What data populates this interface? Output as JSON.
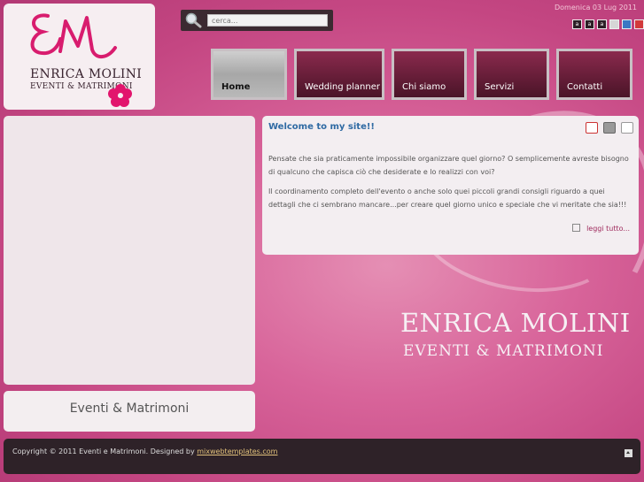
{
  "header": {
    "logo_name": "ENRICA MOLINI",
    "logo_sub": "EVENTI & MATRIMONI",
    "date": "Domenica 03 Lug 2011"
  },
  "search": {
    "placeholder": "cerca..."
  },
  "font_controls": [
    "a",
    "a",
    "a"
  ],
  "color_swatches": [
    "#d6d6d6",
    "#3b78c4",
    "#d23a3a"
  ],
  "nav": {
    "items": [
      {
        "label": "Home",
        "active": true
      },
      {
        "label": "Wedding planner",
        "active": false
      },
      {
        "label": "Chi siamo",
        "active": false
      },
      {
        "label": "Servizi",
        "active": false
      },
      {
        "label": "Contatti",
        "active": false
      }
    ]
  },
  "left": {
    "footer_title": "Eventi & Matrimoni"
  },
  "article": {
    "title": "Welcome to my site!!",
    "p1": "Pensate che sia praticamente impossibile organizzare quel giorno? O semplicemente avreste bisogno di qualcuno che capisca ciò che desiderate e lo realizzi con voi?",
    "p2": "Il coordinamento completo dell'evento o anche solo quei piccoli grandi consigli riguardo a quei dettagli che ci sembrano mancare...per creare quel giorno unico e speciale che vi meritate che sia!!!",
    "read_more": "leggi tutto..."
  },
  "brand": {
    "name": "ENRICA MOLINI",
    "sub": "EVENTI & MATRIMONI"
  },
  "footer": {
    "text": "Copyright © 2011 Eventi e Matrimoni. Designed by ",
    "link": "mixwebtemplates.com"
  }
}
